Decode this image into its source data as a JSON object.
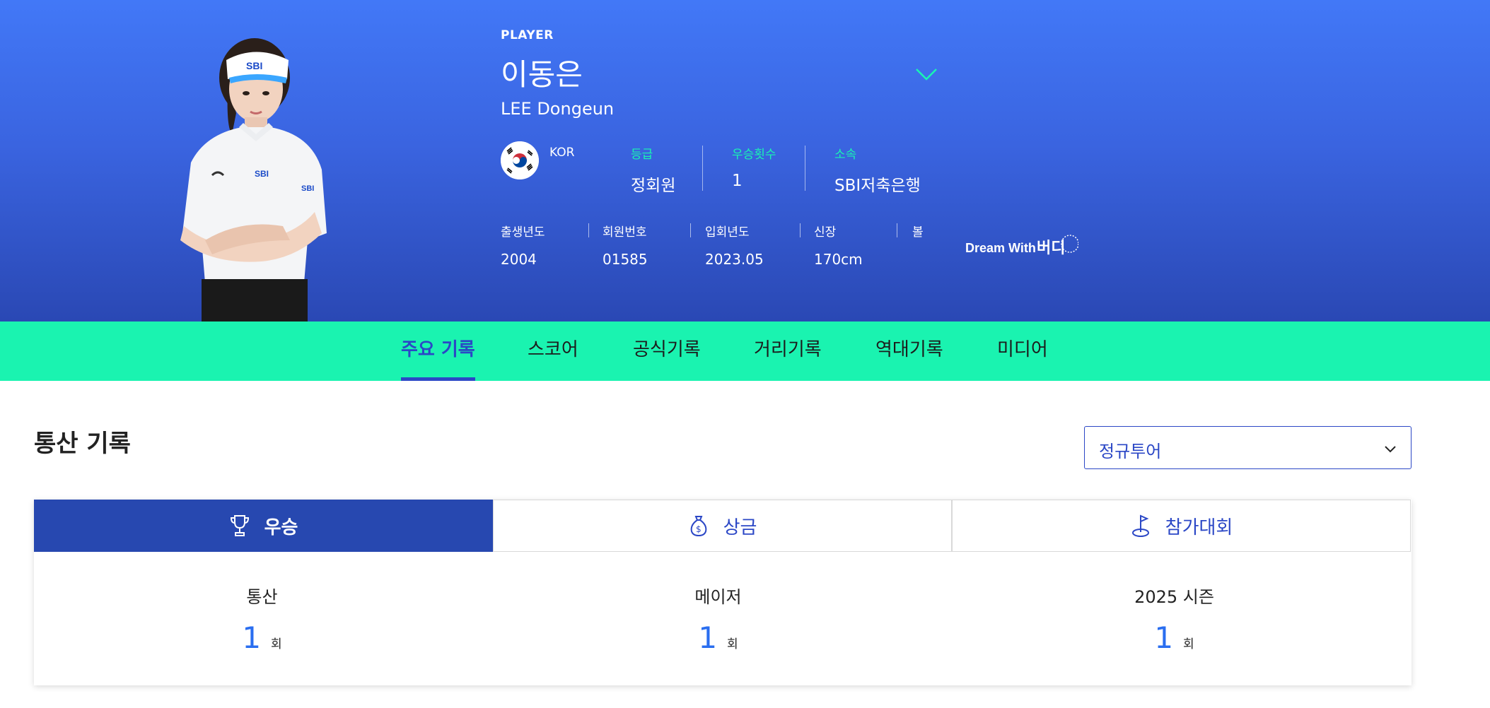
{
  "player": {
    "tag": "PLAYER",
    "name_kr": "이동은",
    "name_en": "LEE Dongeun",
    "nationality": "KOR",
    "attributes": [
      {
        "label": "등급",
        "value": "정회원"
      },
      {
        "label": "우승횟수",
        "value": "1"
      },
      {
        "label": "소속",
        "value": "SBI저축은행"
      }
    ],
    "info": [
      {
        "label": "출생년도",
        "value": "2004"
      },
      {
        "label": "회원번호",
        "value": "01585"
      },
      {
        "label": "입회년도",
        "value": "2023.05"
      },
      {
        "label": "신장",
        "value": "170cm"
      },
      {
        "label": "볼",
        "value": ""
      }
    ],
    "sponsor_logo_text": "Dream With 버디"
  },
  "nav": {
    "tabs": [
      "주요 기록",
      "스코어",
      "공식기록",
      "거리기록",
      "역대기록",
      "미디어"
    ],
    "active_index": 0
  },
  "career": {
    "title": "통산 기록",
    "tour_select": {
      "value": "정규투어"
    },
    "tabs": [
      {
        "label": "우승",
        "icon": "trophy-icon"
      },
      {
        "label": "상금",
        "icon": "money-bag-icon"
      },
      {
        "label": "참가대회",
        "icon": "golf-flag-icon"
      }
    ],
    "active_tab": 0,
    "stats": [
      {
        "label": "통산",
        "value": "1",
        "unit": "회"
      },
      {
        "label": "메이저",
        "value": "1",
        "unit": "회"
      },
      {
        "label": "2025 시즌",
        "value": "1",
        "unit": "회"
      }
    ]
  },
  "colors": {
    "hero_top": "#4278f7",
    "hero_bottom": "#2a48b4",
    "accent_mint": "#1af3b0",
    "brand_blue": "#2b47c6",
    "stat_blue": "#2a6ef0"
  }
}
